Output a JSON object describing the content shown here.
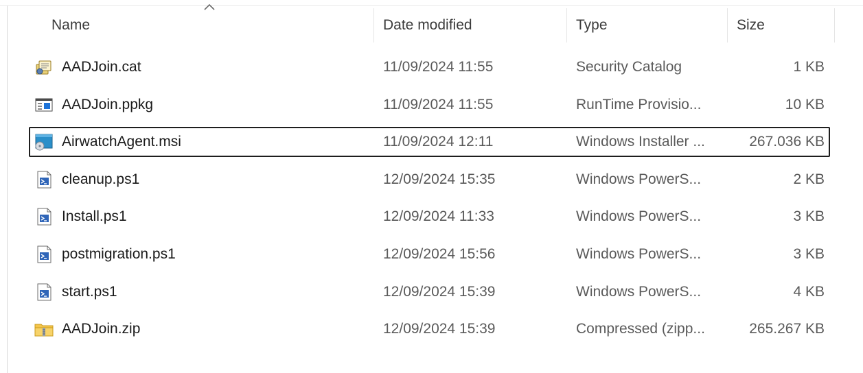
{
  "columns": {
    "name": "Name",
    "date": "Date modified",
    "type": "Type",
    "size": "Size"
  },
  "sort": {
    "column": "name",
    "icon": "sort-caret-up-icon"
  },
  "files": [
    {
      "name": "AADJoin.cat",
      "date": "11/09/2024 11:55",
      "type": "Security Catalog",
      "size": "1 KB",
      "icon": "security-catalog-icon",
      "selected": false
    },
    {
      "name": "AADJoin.ppkg",
      "date": "11/09/2024 11:55",
      "type": "RunTime Provisio...",
      "size": "10 KB",
      "icon": "provisioning-package-icon",
      "selected": false
    },
    {
      "name": "AirwatchAgent.msi",
      "date": "11/09/2024 12:11",
      "type": "Windows Installer ...",
      "size": "267.036 KB",
      "icon": "msi-installer-icon",
      "selected": true
    },
    {
      "name": "cleanup.ps1",
      "date": "12/09/2024 15:35",
      "type": "Windows PowerS...",
      "size": "2 KB",
      "icon": "powershell-script-icon",
      "selected": false
    },
    {
      "name": "Install.ps1",
      "date": "12/09/2024 11:33",
      "type": "Windows PowerS...",
      "size": "3 KB",
      "icon": "powershell-script-icon",
      "selected": false
    },
    {
      "name": "postmigration.ps1",
      "date": "12/09/2024 15:56",
      "type": "Windows PowerS...",
      "size": "3 KB",
      "icon": "powershell-script-icon",
      "selected": false
    },
    {
      "name": "start.ps1",
      "date": "12/09/2024 15:39",
      "type": "Windows PowerS...",
      "size": "4 KB",
      "icon": "powershell-script-icon",
      "selected": false
    },
    {
      "name": "AADJoin.zip",
      "date": "12/09/2024 15:39",
      "type": "Compressed (zipp...",
      "size": "265.267 KB",
      "icon": "zip-folder-icon",
      "selected": false
    }
  ]
}
